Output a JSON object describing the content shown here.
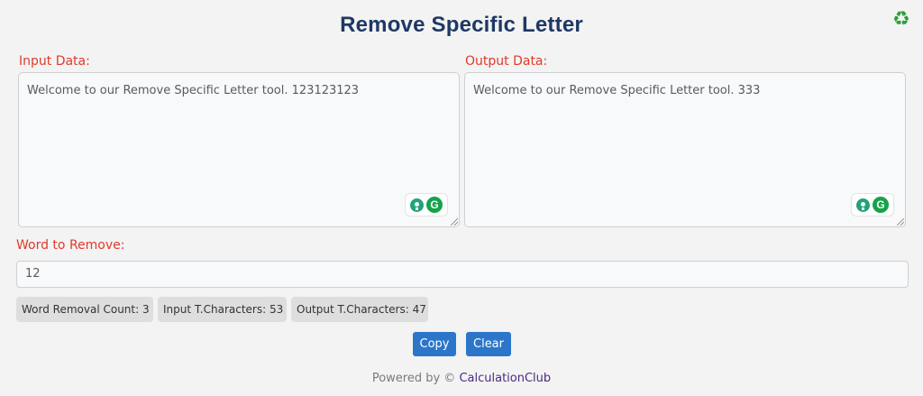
{
  "title": "Remove Specific Letter",
  "icons": {
    "reset": "recycle-icon",
    "grammar_bulb": "lightbulb-icon",
    "grammar_g": "grammarly-icon"
  },
  "input_section": {
    "label": "Input Data:",
    "value": "Welcome to our Remove Specific Letter tool. 123123123"
  },
  "output_section": {
    "label": "Output Data:",
    "value": "Welcome to our Remove Specific Letter tool. 333"
  },
  "word_to_remove": {
    "label": "Word to Remove:",
    "value": "12"
  },
  "stats": {
    "removal_count": "Word Removal Count: 3",
    "input_chars": "Input T.Characters: 53",
    "output_chars": "Output T.Characters: 47"
  },
  "buttons": {
    "copy": "Copy",
    "clear": "Clear"
  },
  "footer": {
    "prefix": "Powered by ©",
    "brand": "CalculationClub"
  },
  "colors": {
    "title": "#1f3864",
    "label": "#e0392b",
    "button": "#2b76c9",
    "brand": "#4b2a84"
  }
}
